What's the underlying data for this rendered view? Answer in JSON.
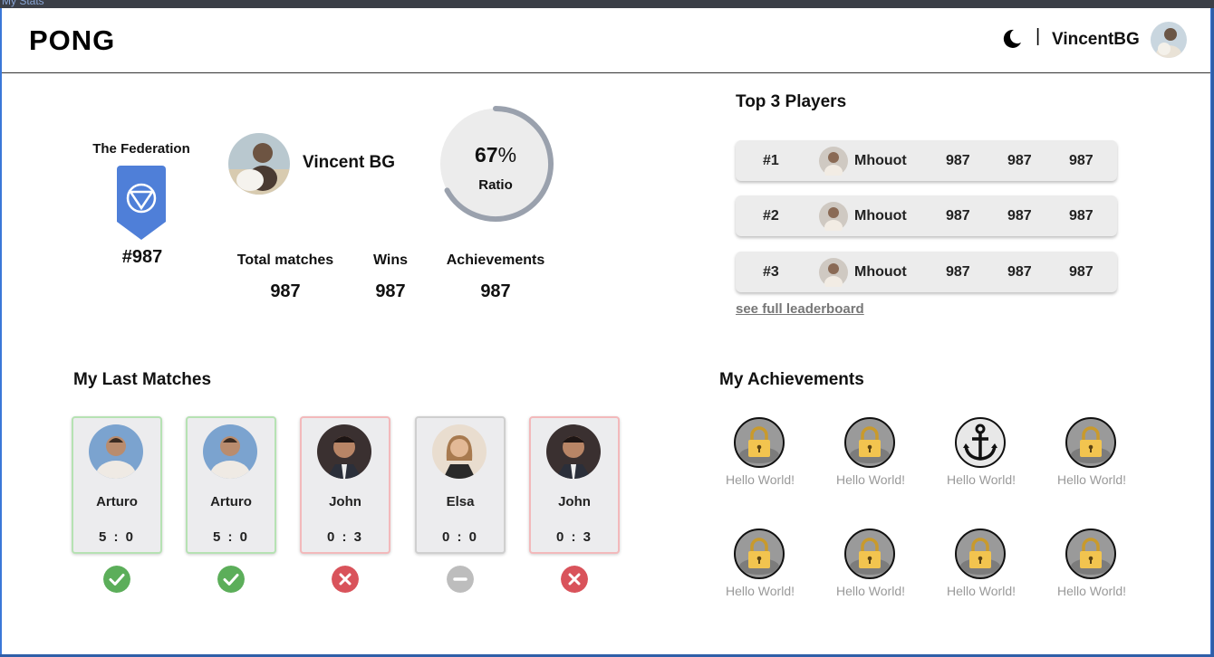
{
  "window": {
    "title": "My Stats"
  },
  "header": {
    "logo": "PONG",
    "separator": "|",
    "username": "VincentBG"
  },
  "profile": {
    "group_label": "The Federation",
    "rank": "#987",
    "name": "Vincent BG",
    "ratio_value": "67",
    "ratio_unit": "%",
    "ratio_label": "Ratio",
    "ratio_fraction": 0.67,
    "stats": [
      {
        "label": "Total matches",
        "value": "987"
      },
      {
        "label": "Wins",
        "value": "987"
      },
      {
        "label": "Achievements",
        "value": "987"
      }
    ]
  },
  "leaderboard": {
    "title": "Top 3 Players",
    "rows": [
      {
        "rank": "#1",
        "name": "Mhouot",
        "v1": "987",
        "v2": "987",
        "v3": "987"
      },
      {
        "rank": "#2",
        "name": "Mhouot",
        "v1": "987",
        "v2": "987",
        "v3": "987"
      },
      {
        "rank": "#3",
        "name": "Mhouot",
        "v1": "987",
        "v2": "987",
        "v3": "987"
      }
    ],
    "link": "see full leaderboard"
  },
  "matches": {
    "title": "My Last Matches",
    "items": [
      {
        "name": "Arturo",
        "score": "5 : 0",
        "result": "win"
      },
      {
        "name": "Arturo",
        "score": "5 : 0",
        "result": "win"
      },
      {
        "name": "John",
        "score": "0 : 3",
        "result": "loss"
      },
      {
        "name": "Elsa",
        "score": "0 : 0",
        "result": "draw"
      },
      {
        "name": "John",
        "score": "0 : 3",
        "result": "loss"
      }
    ]
  },
  "achievements": {
    "title": "My Achievements",
    "items": [
      {
        "label": "Hello World!",
        "icon": "lock-icon"
      },
      {
        "label": "Hello World!",
        "icon": "lock-icon"
      },
      {
        "label": "Hello World!",
        "icon": "anchor-icon"
      },
      {
        "label": "Hello World!",
        "icon": "lock-icon"
      },
      {
        "label": "Hello World!",
        "icon": "lock-icon"
      },
      {
        "label": "Hello World!",
        "icon": "lock-icon"
      },
      {
        "label": "Hello World!",
        "icon": "lock-icon"
      },
      {
        "label": "Hello World!",
        "icon": "lock-icon"
      }
    ]
  },
  "colors": {
    "win": "#5cae5a",
    "loss": "#d9535b",
    "draw": "#bdbdbd",
    "badge": "#4f7fd8",
    "ring": "#9aa1ad"
  }
}
